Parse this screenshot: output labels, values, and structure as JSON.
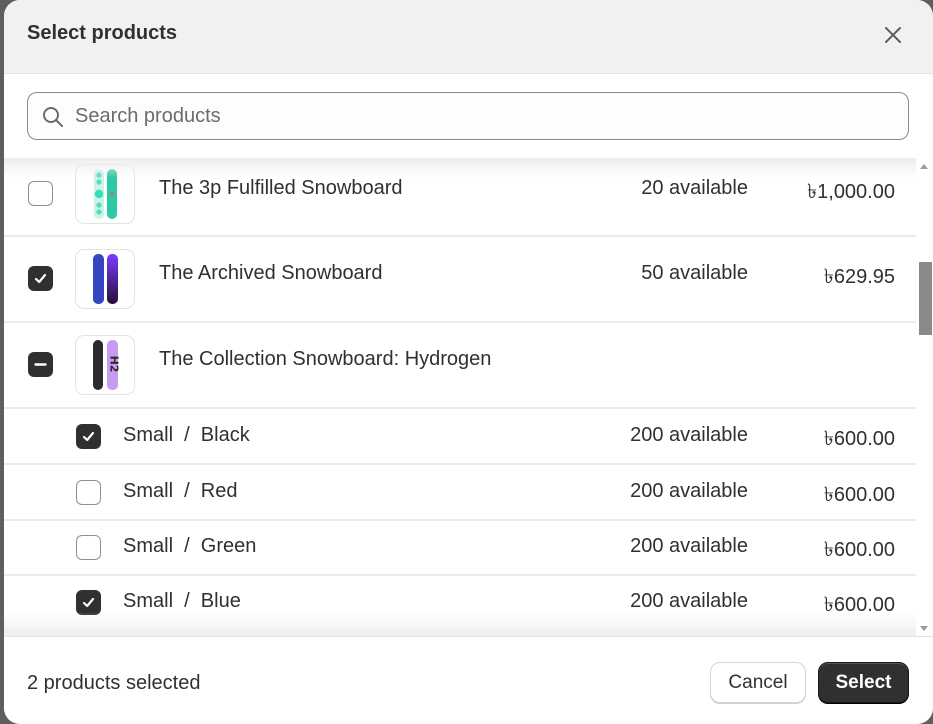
{
  "dialog": {
    "title": "Select products",
    "close_label": "Close"
  },
  "search": {
    "placeholder": "Search products",
    "value": ""
  },
  "products": [
    {
      "name": "The 3p Fulfilled Snowboard",
      "availability": "20 available",
      "price": "৳1,000.00",
      "selection": "unchecked",
      "thumbnail": "snowboard-teal-image"
    },
    {
      "name": "The Archived Snowboard",
      "availability": "50 available",
      "price": "৳629.95",
      "selection": "checked",
      "thumbnail": "snowboard-blue-purple-image"
    },
    {
      "name": "The Collection Snowboard: Hydrogen",
      "availability": "",
      "price": "",
      "selection": "indeterminate",
      "thumbnail": "snowboard-black-lilac-image",
      "variants": [
        {
          "name": "Small  /  Black",
          "availability": "200 available",
          "price": "৳600.00",
          "selection": "checked"
        },
        {
          "name": "Small  /  Red",
          "availability": "200 available",
          "price": "৳600.00",
          "selection": "unchecked"
        },
        {
          "name": "Small  /  Green",
          "availability": "200 available",
          "price": "৳600.00",
          "selection": "unchecked"
        },
        {
          "name": "Small  /  Blue",
          "availability": "200 available",
          "price": "৳600.00",
          "selection": "checked"
        }
      ]
    }
  ],
  "footer": {
    "selected_count_text": "2 products selected",
    "cancel_label": "Cancel",
    "select_label": "Select"
  },
  "colors": {
    "primary_button": "#303030",
    "checkbox_checked": "#303030",
    "header_bg": "#f1f1f1"
  }
}
